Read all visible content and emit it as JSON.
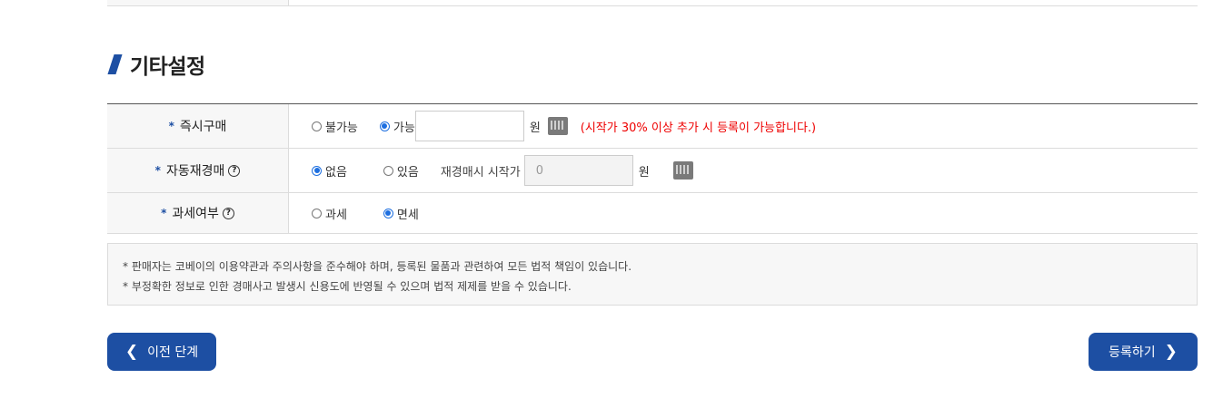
{
  "section": {
    "title": "기타설정"
  },
  "rows": {
    "instant_buy": {
      "label": "즉시구매",
      "option_no": "불가능",
      "option_yes": "가능",
      "value": "",
      "unit": "원",
      "notice": "(시작가 30% 이상 추가 시 등록이 가능합니다.)",
      "selected": "가능"
    },
    "auto_rebid": {
      "label": "자동재경매",
      "option_none": "없음",
      "option_yes": "있음",
      "start_price_label": "재경매시 시작가",
      "start_price_value": "0",
      "unit": "원",
      "selected": "없음"
    },
    "tax": {
      "label": "과세여부",
      "option_taxable": "과세",
      "option_exempt": "면세",
      "selected": "면세"
    }
  },
  "required_mark": "*",
  "help_mark": "?",
  "notes": [
    "* 판매자는 코베이의 이용약관과 주의사항을 준수해야 하며, 등록된 물품과 관련하여 모든 법적 책임이 있습니다.",
    "* 부정확한 정보로 인한 경매사고 발생시 신용도에 반영될 수 있으며 법적 제제를 받을 수 있습니다."
  ],
  "buttons": {
    "prev": "이전 단계",
    "next": "등록하기"
  },
  "colors": {
    "accent": "#1d4fa3",
    "notice": "#ee0000",
    "radio": "#1d6fe0"
  }
}
